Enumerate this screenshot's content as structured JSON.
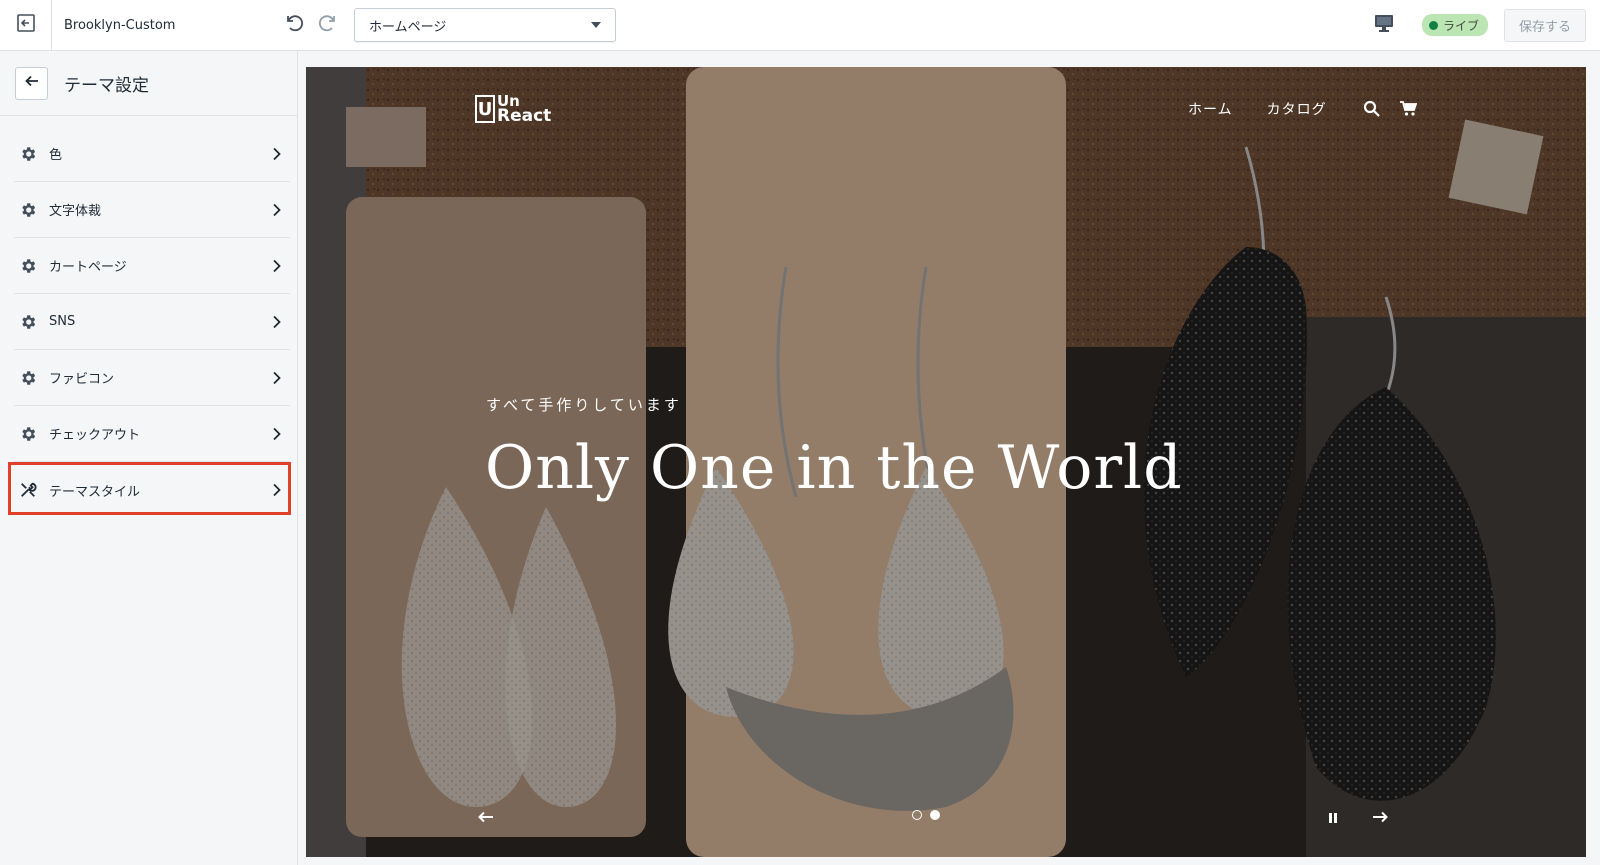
{
  "topbar": {
    "theme_name": "Brooklyn-Custom",
    "page_select_value": "ホームページ",
    "live_label": "ライブ",
    "save_label": "保存する"
  },
  "sidebar": {
    "title": "テーマ設定",
    "items": [
      {
        "label": "色",
        "icon": "gear-icon"
      },
      {
        "label": "文字体裁",
        "icon": "gear-icon"
      },
      {
        "label": "カートページ",
        "icon": "gear-icon"
      },
      {
        "label": "SNS",
        "icon": "gear-icon"
      },
      {
        "label": "ファビコン",
        "icon": "gear-icon"
      },
      {
        "label": "チェックアウト",
        "icon": "gear-icon"
      },
      {
        "label": "テーマスタイル",
        "icon": "tools-icon",
        "highlighted": true
      }
    ]
  },
  "preview": {
    "logo_mark": "U",
    "logo_line1": "Un",
    "logo_line2": "React",
    "nav": [
      "ホーム",
      "カタログ"
    ],
    "hero_subtitle": "すべて手作りしています",
    "hero_title": "Only One in the World",
    "slide_count": 2,
    "active_slide": 2
  },
  "colors": {
    "highlight": "#e1402b",
    "live_badge_bg": "#bbe5b3",
    "live_dot": "#108043",
    "sidebar_bg": "#f4f6f8"
  }
}
